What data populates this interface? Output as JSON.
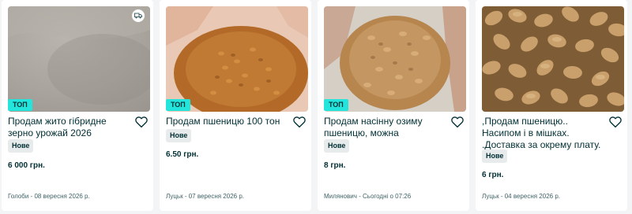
{
  "listings": [
    {
      "title": "Продам жито гібридне зерно урожай 2026",
      "badge_top": "ТОП",
      "condition": "Нове",
      "price": "6 000 грн.",
      "location_date": "Голоби - 08 вересня 2026 р.",
      "delivery_icon": "truck-icon",
      "favorite_icon": "heart-outline-icon"
    },
    {
      "title": "Продам пшеницю 100 тон",
      "badge_top": "ТОП",
      "condition": "Нове",
      "price": "6.50 грн.",
      "location_date": "Луцьк - 07 вересня 2026 р.",
      "favorite_icon": "heart-outline-icon"
    },
    {
      "title": "Продам насінну озиму пшеницю, можна протруєну",
      "badge_top": "ТОП",
      "condition": "Нове",
      "price": "8 грн.",
      "location_date": "Милянович - Сьогодні о 07:26",
      "favorite_icon": "heart-outline-icon"
    },
    {
      "title": ",Продам пшеницю.. Насипом і в мішках. .Доставка за окрему плату.",
      "condition": "Нове",
      "price": "6 грн.",
      "location_date": "Луцьк - 04 вересня 2026 р.",
      "favorite_icon": "heart-outline-icon"
    }
  ],
  "colors": {
    "top_badge": "#23e5db",
    "text": "#002f34",
    "meta_text": "#406367",
    "background": "#f2f4f5"
  }
}
